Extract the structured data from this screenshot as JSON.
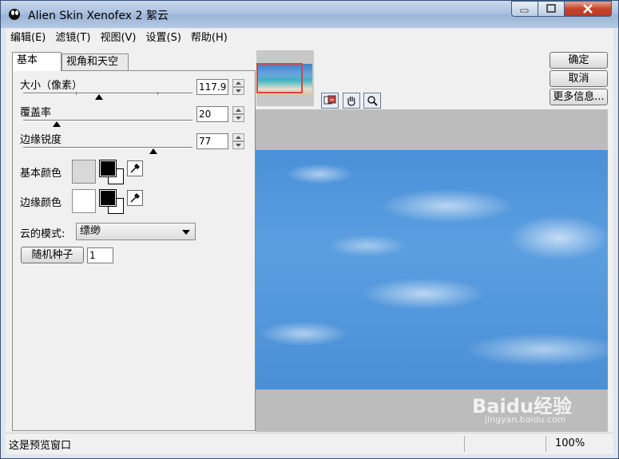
{
  "window": {
    "title": "Alien Skin Xenofex 2 絮云"
  },
  "menu": [
    "编辑(E)",
    "滤镜(T)",
    "视图(V)",
    "设置(S)",
    "帮助(H)"
  ],
  "tabs": [
    "基本",
    "视角和天空"
  ],
  "params": {
    "size": {
      "label": "大小（像素）",
      "value": "117.9",
      "level": 0.45
    },
    "coverage": {
      "label": "覆盖率",
      "value": "20",
      "level": 0.2
    },
    "edge": {
      "label": "边缘锐度",
      "value": "77",
      "level": 0.77
    }
  },
  "colors": {
    "base_label": "基本颜色",
    "edge_label": "边缘颜色",
    "base_swatch": "#d8d8d8",
    "edge_swatch": "#ffffff"
  },
  "cloud_mode": {
    "label": "云的模式:",
    "value": "缥缈"
  },
  "seed": {
    "button": "随机种子",
    "value": "1"
  },
  "buttons": {
    "ok": "确定",
    "cancel": "取消",
    "more": "更多信息..."
  },
  "status": {
    "text": "这是预览窗口",
    "zoom": "100%"
  },
  "watermark": {
    "main": "Baidu经验",
    "sub": "jingyan.baidu.com"
  }
}
